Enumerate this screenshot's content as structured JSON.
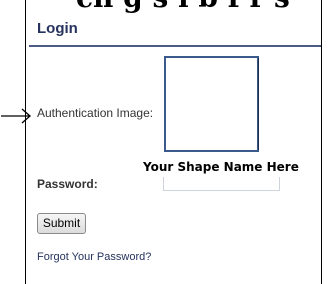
{
  "header": {
    "cut_off_heading": "ch g s   l  b f r s",
    "title": "Login"
  },
  "form": {
    "auth_image_label": "Authentication Image:",
    "shape_name_caption": "Your Shape Name Here",
    "password_label": "Password:",
    "password_value": "",
    "submit_label": "Submit",
    "forgot_link": "Forgot Your Password?"
  },
  "icons": {
    "arrow": "arrow-right-icon"
  },
  "colors": {
    "title": "#26335e",
    "header_rule": "#4b5b86",
    "auth_image_border": "#3a5a8c"
  }
}
